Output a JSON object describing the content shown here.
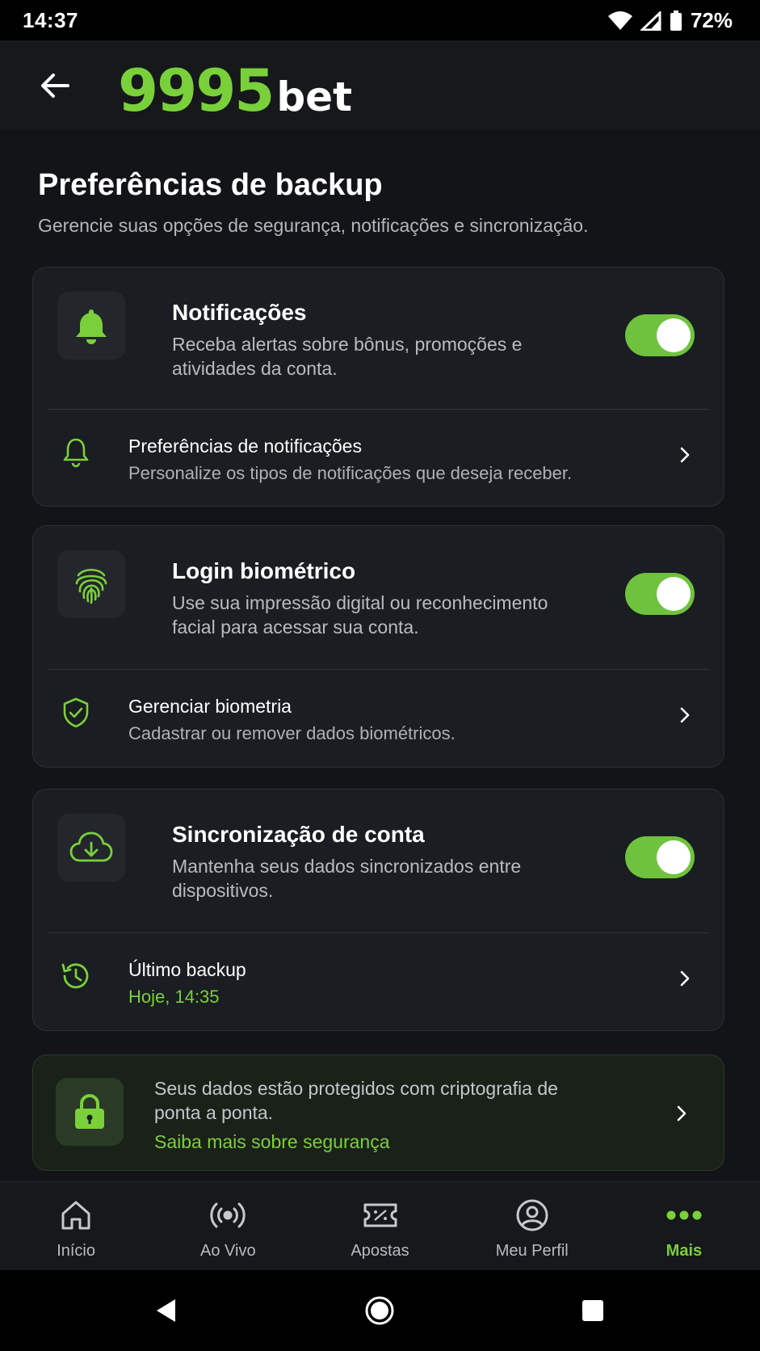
{
  "status_bar": {
    "time": "14:37",
    "battery": "72%"
  },
  "header": {
    "logo_number": "9995",
    "logo_text": "bet"
  },
  "page": {
    "title": "Preferências de backup",
    "subtitle": "Gerencie suas opções de segurança, notificações e sincronização."
  },
  "cards": [
    {
      "title": "Notificações",
      "description": "Receba alertas sobre bônus, promoções e atividades da conta.",
      "toggle_on": true,
      "row_title": "Preferências de notificações",
      "row_subtitle": "Personalize os tipos de notificações que deseja receber."
    },
    {
      "title": "Login biométrico",
      "description": "Use sua impressão digital ou reconhecimento facial para acessar sua conta.",
      "toggle_on": true,
      "row_title": "Gerenciar biometria",
      "row_subtitle": "Cadastrar ou remover dados biométricos."
    },
    {
      "title": "Sincronização de conta",
      "description": "Mantenha seus dados sincronizados entre dispositivos.",
      "toggle_on": true,
      "row_title": "Último backup",
      "row_subtitle": "Hoje, 14:35"
    }
  ],
  "security_banner": {
    "text": "Seus dados estão protegidos com criptografia de ponta a ponta.",
    "link": "Saiba mais sobre segurança"
  },
  "bottom_nav": [
    {
      "label": "Início",
      "icon": "home-icon"
    },
    {
      "label": "Ao Vivo",
      "icon": "live-icon"
    },
    {
      "label": "Apostas",
      "icon": "ticket-icon"
    },
    {
      "label": "Meu Perfil",
      "icon": "profile-icon"
    },
    {
      "label": "Mais",
      "icon": "more-icon",
      "active": true
    }
  ],
  "colors": {
    "accent": "#7ad03a",
    "toggle": "#6fc23d",
    "background": "#121417",
    "card": "#1a1d21"
  }
}
